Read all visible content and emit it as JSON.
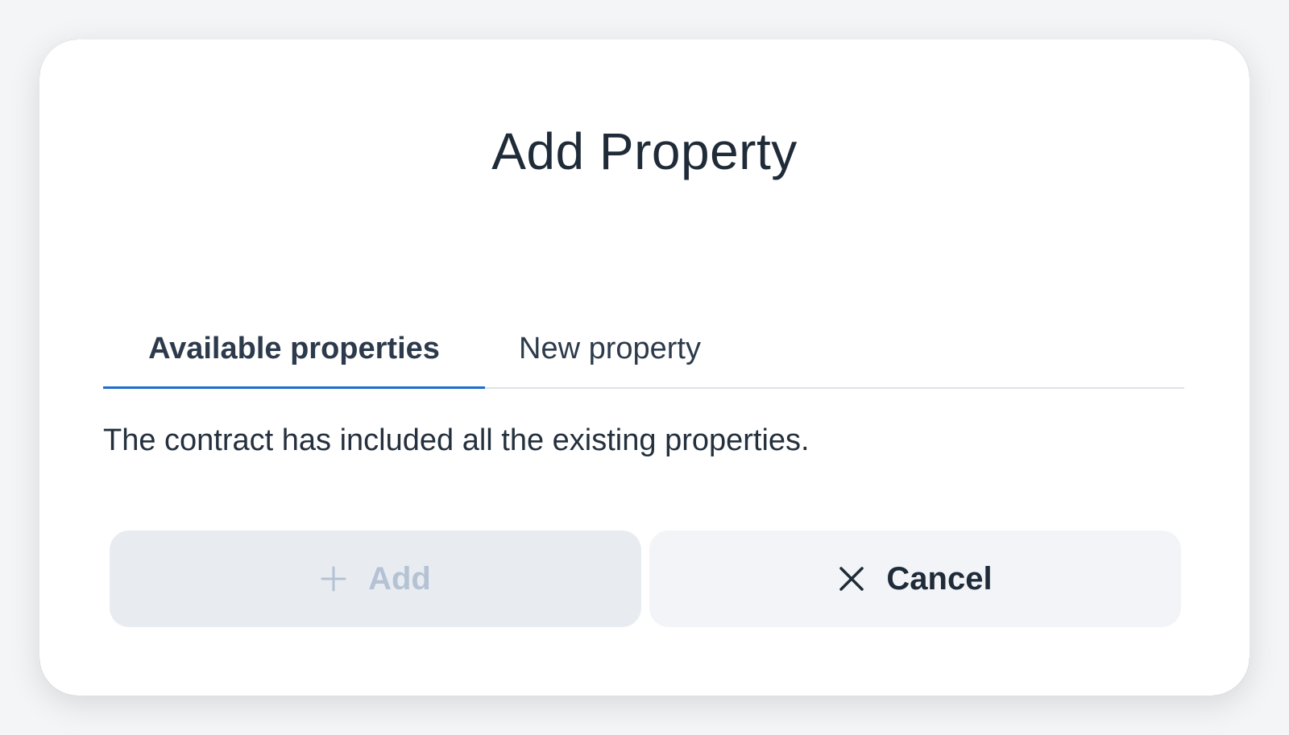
{
  "dialog": {
    "title": "Add Property",
    "tabs": [
      {
        "label": "Available properties",
        "active": true
      },
      {
        "label": "New property",
        "active": false
      }
    ],
    "message": "The contract has included all the existing properties.",
    "buttons": {
      "add": {
        "label": "Add",
        "icon": "plus-icon",
        "disabled": true
      },
      "cancel": {
        "label": "Cancel",
        "icon": "close-icon"
      }
    }
  },
  "colors": {
    "accent": "#1b6ecf",
    "text": "#1f2b38",
    "disabled_text": "#b4c2d3",
    "disabled_bg": "#e8ecf1",
    "secondary_bg": "#f2f4f7",
    "frame": "#25387a"
  }
}
